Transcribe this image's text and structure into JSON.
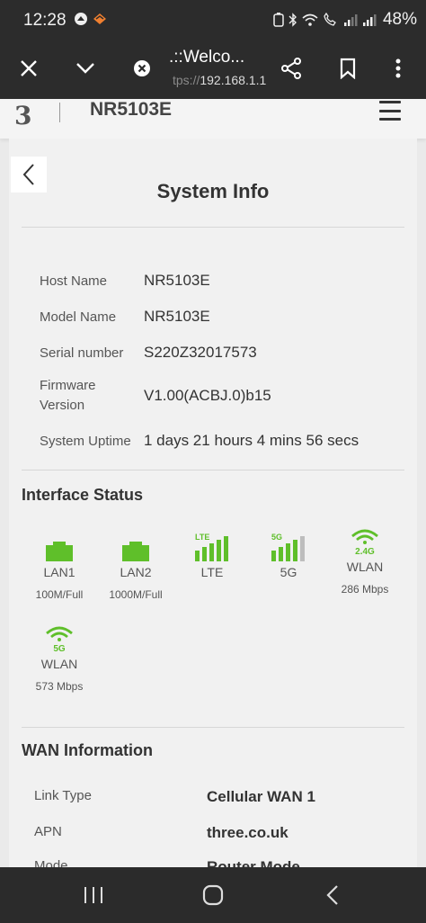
{
  "status_bar": {
    "time": "12:28",
    "battery": "48%"
  },
  "toolbar": {
    "title": ".::Welco...",
    "url_faded": "tps://",
    "url_host": "192.168.1.1"
  },
  "site": {
    "logo": "3",
    "model": "NR5103E"
  },
  "system_info": {
    "title": "System Info",
    "rows": [
      {
        "label": "Host Name",
        "value": "NR5103E"
      },
      {
        "label": "Model Name",
        "value": "NR5103E"
      },
      {
        "label": "Serial number",
        "value": "S220Z32017573"
      },
      {
        "label": "Firmware Version",
        "value": "V1.00(ACBJ.0)b15"
      },
      {
        "label": "System Uptime",
        "value": "1 days 21 hours 4 mins 56 secs"
      }
    ]
  },
  "interface_status": {
    "title": "Interface Status",
    "items": [
      {
        "name": "LAN1",
        "speed": "100M/Full",
        "badge": ""
      },
      {
        "name": "LAN2",
        "speed": "1000M/Full",
        "badge": ""
      },
      {
        "name": "LTE",
        "speed": "",
        "badge": "LTE"
      },
      {
        "name": "5G",
        "speed": "",
        "badge": "5G"
      },
      {
        "name": "WLAN",
        "speed": "286 Mbps",
        "badge": "2.4G"
      },
      {
        "name": "WLAN",
        "speed": "573 Mbps",
        "badge": "5G"
      }
    ]
  },
  "wan_info": {
    "title": "WAN Information",
    "rows": [
      {
        "label": "Link Type",
        "value": "Cellular WAN 1"
      },
      {
        "label": "APN",
        "value": "three.co.uk"
      },
      {
        "label": "Mode",
        "value": "Router Mode"
      }
    ]
  },
  "colors": {
    "accent_green": "#5fbf2a",
    "gray_bar": "#bdbdbd"
  },
  "icons": {
    "close": "close-icon",
    "dropdown": "chevron-down-icon",
    "site_settings": "site-settings-icon",
    "share": "share-icon",
    "bookmark": "bookmark-icon",
    "more": "more-vertical-icon",
    "menu": "hamburger-menu-icon",
    "back": "chevron-left-icon"
  }
}
